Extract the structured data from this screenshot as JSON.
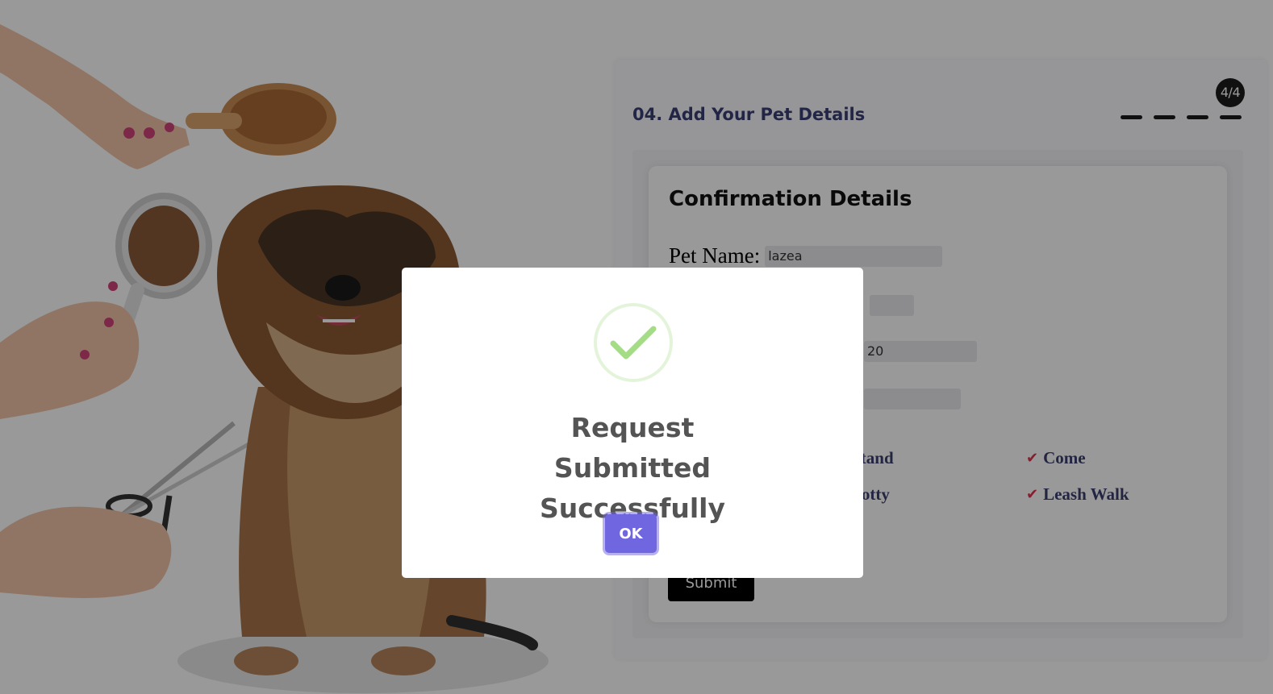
{
  "wizard": {
    "step_title": "04. Add Your Pet Details",
    "step_indicator": "4/4",
    "total_steps": 4,
    "current_step": 4
  },
  "confirmation": {
    "title": "Confirmation Details",
    "fields": [
      {
        "label": "Pet Name:",
        "value": "lazea"
      },
      {
        "label": "",
        "value": ""
      },
      {
        "label": "",
        "value": "20"
      },
      {
        "label": "",
        "value": ""
      }
    ],
    "skills": [
      {
        "label": "Stand",
        "checked": true
      },
      {
        "label": "Come",
        "checked": true
      },
      {
        "label": "Potty",
        "checked": true
      },
      {
        "label": "Leash Walk",
        "checked": true
      }
    ],
    "submit_label": "Submit"
  },
  "dialog": {
    "title": "Request Submitted Successfully",
    "ok_label": "OK",
    "icon": "success-check-icon"
  },
  "colors": {
    "accent": "#7066e0",
    "heading": "#3a3f73",
    "check": "#e0334f",
    "success_green": "#a5dc86",
    "overlay": "rgba(0,0,0,0.4)"
  }
}
